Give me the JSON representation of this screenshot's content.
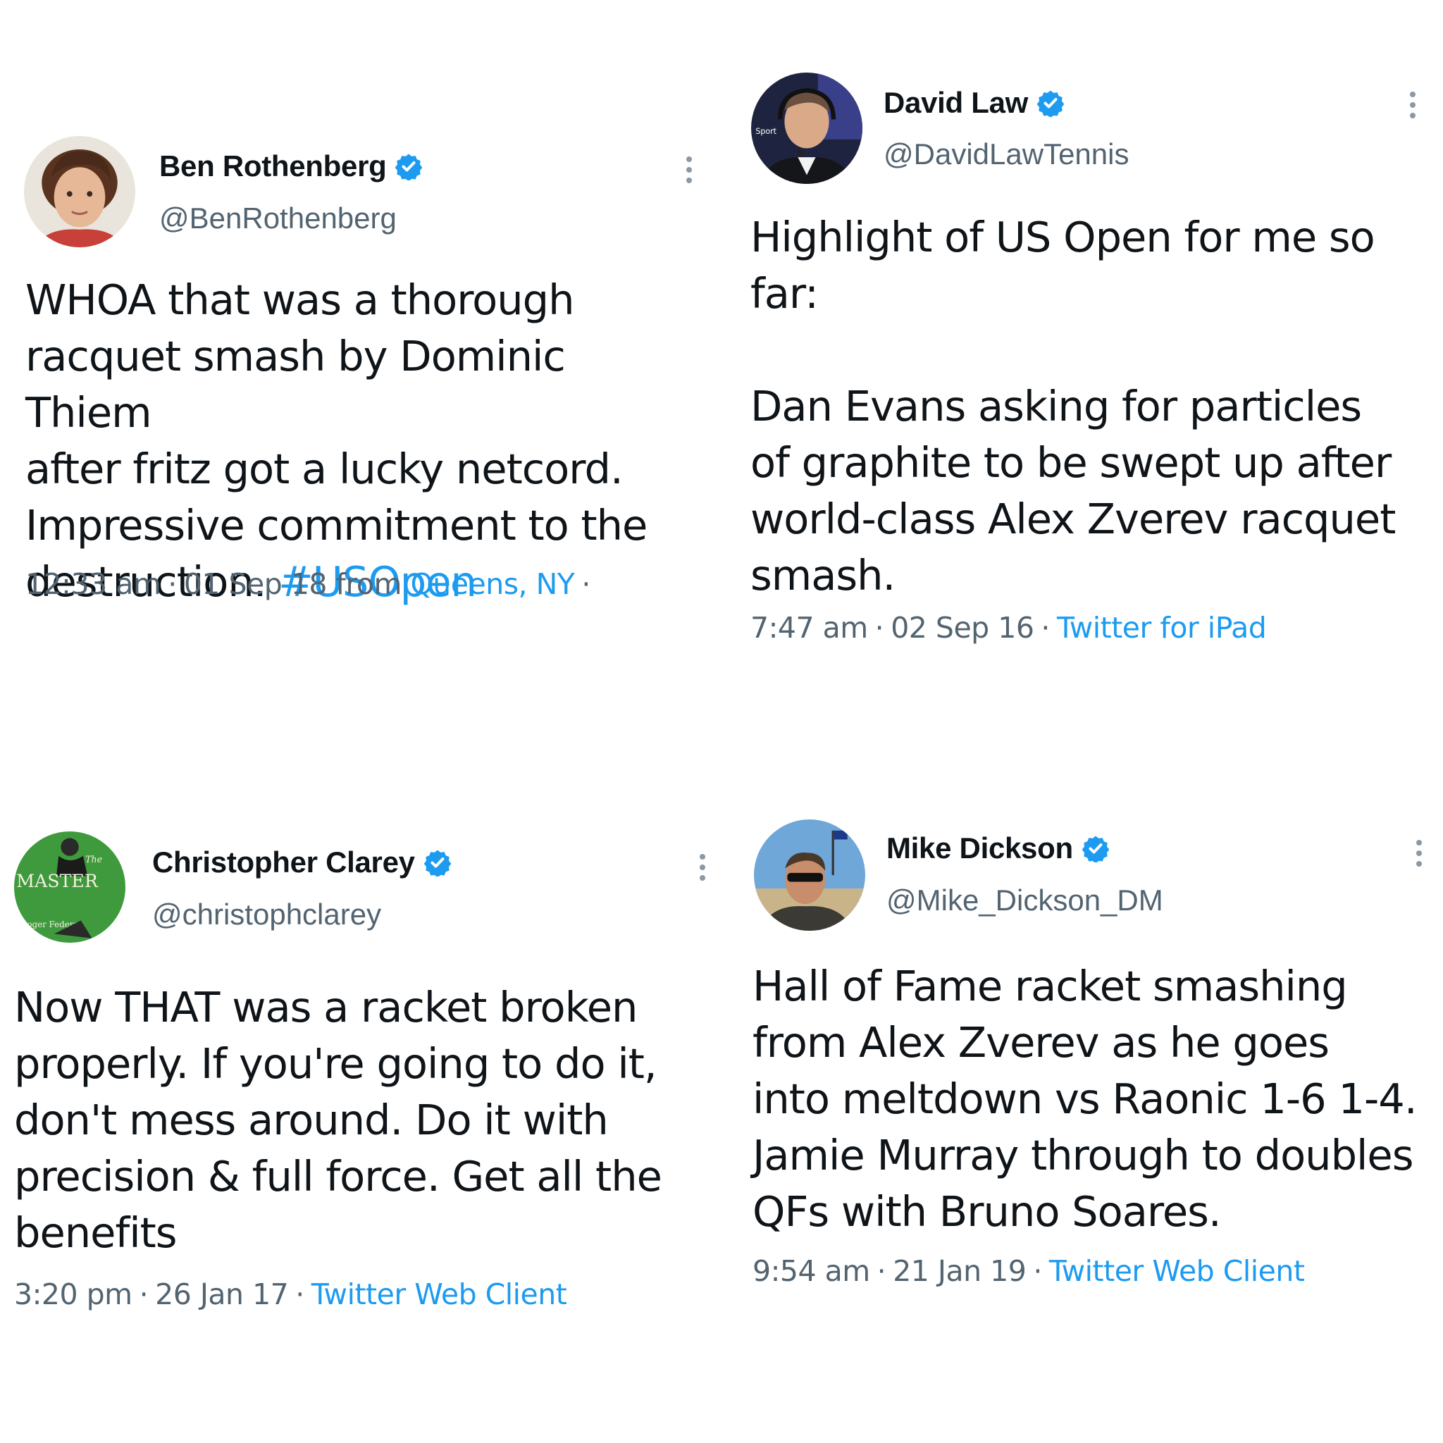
{
  "colors": {
    "link": "#1d9bf0",
    "verified": "#1d9bf0",
    "secondary_text": "#536471",
    "primary_text": "#0f1419"
  },
  "tweets": [
    {
      "name": "Ben Rothenberg",
      "handle": "@BenRothenberg",
      "text": "WHOA that was a thorough\nracquet smash by Dominic Thiem\nafter fritz got a lucky netcord.\nImpressive commitment to the\ndestruction. ",
      "hashtag": "#USOpen",
      "time": "12:33 am",
      "date": "01 Sep 18 from",
      "source": "Queens, NY",
      "trailing": "·",
      "verified_icon": "verified-badge-icon",
      "more_icon": "more-vertical-icon"
    },
    {
      "name": "David Law",
      "handle": "@DavidLawTennis",
      "text": "Highlight of US Open for me so\nfar:\n\nDan Evans asking for particles\nof graphite to be swept up after\nworld-class Alex Zverev racquet\nsmash.",
      "time": "7:47 am",
      "date": "02 Sep 16",
      "source": "Twitter for iPad",
      "avatar_label": "Sport",
      "verified_icon": "verified-badge-icon",
      "more_icon": "more-vertical-icon"
    },
    {
      "name": "Christopher Clarey",
      "handle": "@christophclarey",
      "text": "Now THAT was a racket broken\nproperly. If you're going to do it,\ndon't mess around. Do it with\nprecision & full force. Get all the\nbenefits",
      "time": "3:20 pm",
      "date": "26 Jan 17",
      "source": "Twitter Web Client",
      "avatar_label": "MASTER",
      "avatar_label_small": "The",
      "avatar_label_bottom": "Roger Federer",
      "verified_icon": "verified-badge-icon",
      "more_icon": "more-vertical-icon"
    },
    {
      "name": "Mike Dickson",
      "handle": "@Mike_Dickson_DM",
      "text": "Hall of Fame racket smashing\nfrom Alex Zverev as he goes\ninto meltdown vs Raonic 1-6 1-4.\nJamie Murray through to doubles\nQFs with Bruno Soares.",
      "time": "9:54 am",
      "date": "21 Jan 19",
      "source": "Twitter Web Client",
      "verified_icon": "verified-badge-icon",
      "more_icon": "more-vertical-icon"
    }
  ]
}
